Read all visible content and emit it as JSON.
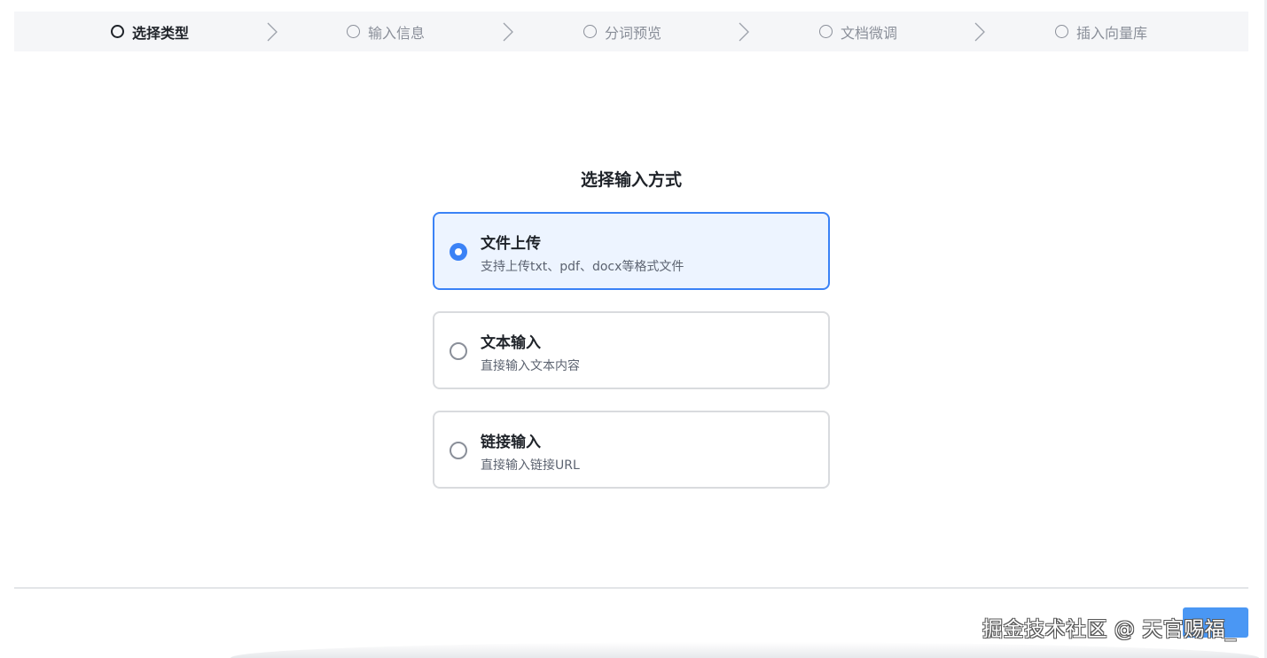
{
  "steps": [
    {
      "label": "选择类型",
      "active": true
    },
    {
      "label": "输入信息",
      "active": false
    },
    {
      "label": "分词预览",
      "active": false
    },
    {
      "label": "文档微调",
      "active": false
    },
    {
      "label": "插入向量库",
      "active": false
    }
  ],
  "main": {
    "title": "选择输入方式",
    "options": [
      {
        "title": "文件上传",
        "desc": "支持上传txt、pdf、docx等格式文件",
        "selected": true
      },
      {
        "title": "文本输入",
        "desc": "直接输入文本内容",
        "selected": false
      },
      {
        "title": "链接输入",
        "desc": "直接输入链接URL",
        "selected": false
      }
    ]
  },
  "footer": {
    "next_label": ""
  },
  "watermark": "掘金技术社区 @ 天官赐福_",
  "colors": {
    "accent": "#3b82f6",
    "selected_bg": "#edf4ff",
    "steps_bg": "#f5f6f8",
    "button": "#4a97f4"
  }
}
